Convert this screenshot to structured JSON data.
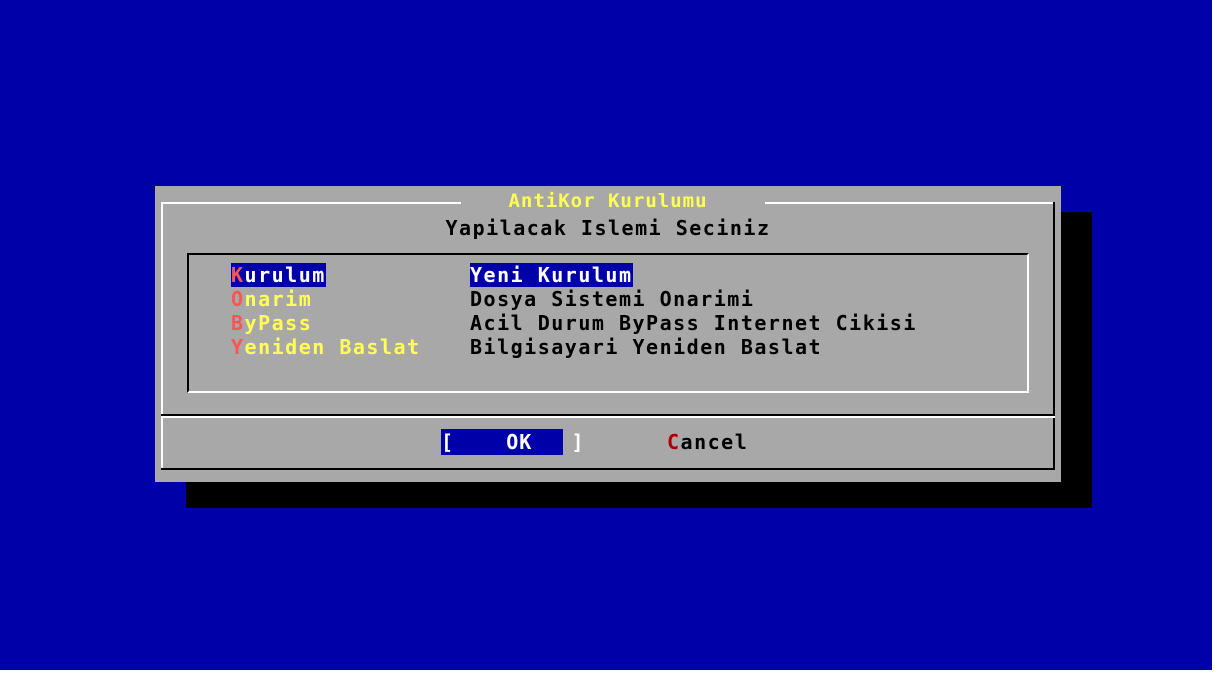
{
  "dialog": {
    "title": "AntiKor Kurulumu",
    "prompt": "Yapilacak Islemi Seciniz"
  },
  "menu": [
    {
      "hotkey": "K",
      "tag_rest": "urulum",
      "description": "Yeni Kurulum",
      "selected": true
    },
    {
      "hotkey": "O",
      "tag_rest": "narim",
      "description": "Dosya Sistemi Onarimi",
      "selected": false
    },
    {
      "hotkey": "B",
      "tag_rest": "yPass",
      "description": "Acil Durum ByPass Internet Cikisi",
      "selected": false
    },
    {
      "hotkey": "Y",
      "tag_rest": "eniden Baslat",
      "description": "Bilgisayari Yeniden Baslat",
      "selected": false
    }
  ],
  "buttons": {
    "ok_left_bracket": "[",
    "ok_hotkey": "O",
    "ok_rest": "K",
    "ok_right_bracket": "]",
    "cancel_hotkey": "C",
    "cancel_rest": "ancel"
  },
  "colors": {
    "background": "#0000a8",
    "dialog": "#a8a8a8",
    "title": "#ffff54",
    "hotkey": "#ff5454",
    "selection": "#0000a8"
  }
}
